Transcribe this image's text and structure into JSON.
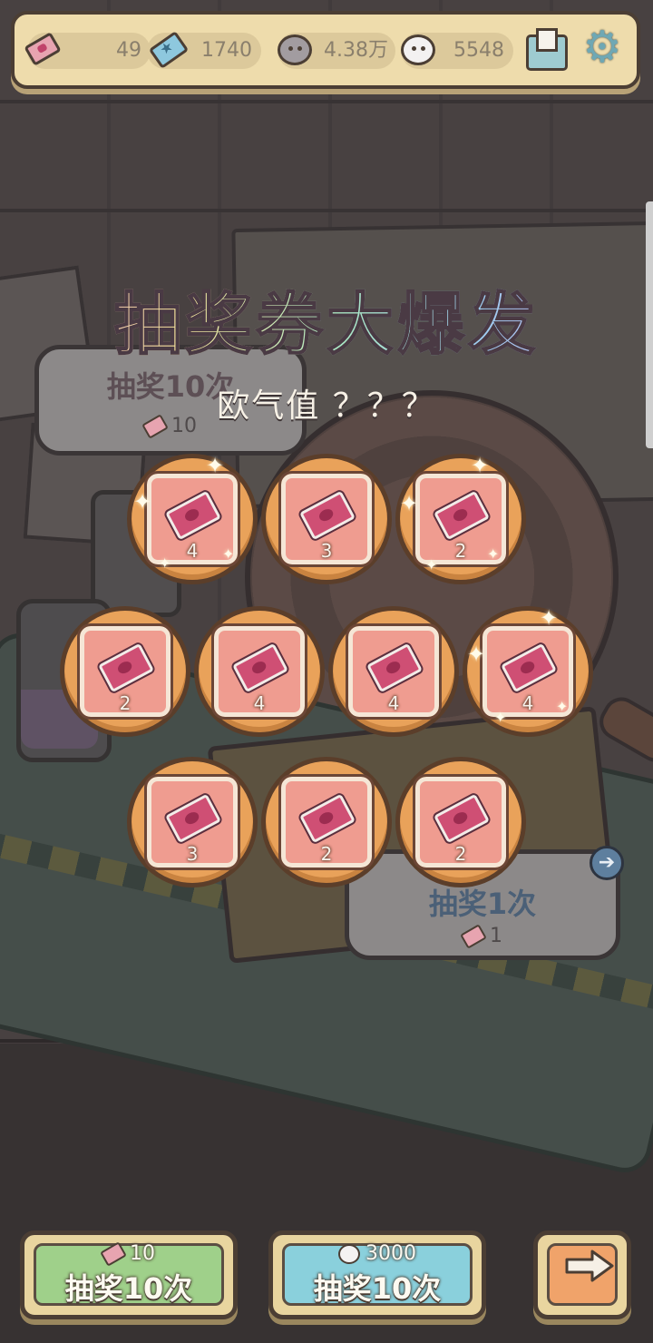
{
  "resources": {
    "tickets": "49",
    "crystals": "1740",
    "gray_bubbles": "4.38万",
    "white_bubbles": "5548"
  },
  "title": "抽奖券大爆发",
  "subtitle": "欧气值 ？？？",
  "bg_panel_left": {
    "label": "抽奖10次",
    "cost": "10"
  },
  "bg_panel_right": {
    "label": "抽奖1次",
    "cost": "1"
  },
  "prizes": [
    {
      "count": "4"
    },
    {
      "count": "3"
    },
    {
      "count": "2"
    },
    {
      "count": "2"
    },
    {
      "count": "4"
    },
    {
      "count": "4"
    },
    {
      "count": "4"
    },
    {
      "count": "3"
    },
    {
      "count": "2"
    },
    {
      "count": "2"
    }
  ],
  "buttons": {
    "draw_ticket": {
      "cost": "10",
      "label": "抽奖10次",
      "color": "#9fd08a"
    },
    "draw_bubble": {
      "cost": "3000",
      "label": "抽奖10次",
      "color": "#8ad0dc"
    },
    "next": {
      "color": "#f0a36a"
    }
  },
  "icons": [
    "ticket-icon",
    "crystal-icon",
    "gray-bubble-icon",
    "white-bubble-icon",
    "mail-icon",
    "gear-icon",
    "arrow-right-icon"
  ]
}
